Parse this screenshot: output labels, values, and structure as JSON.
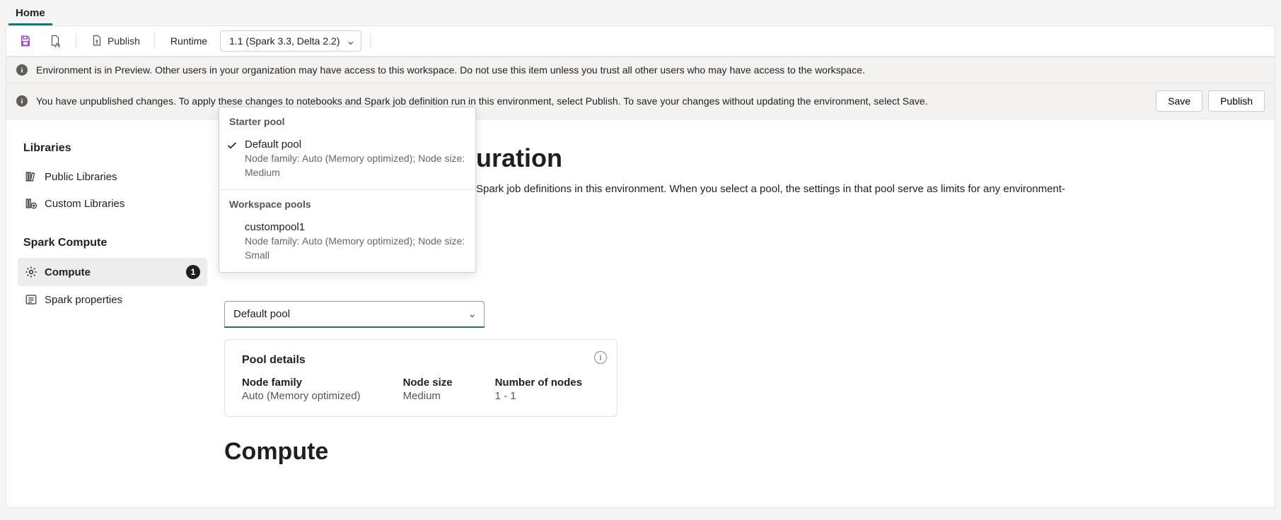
{
  "tab": {
    "home": "Home"
  },
  "toolbar": {
    "publish": "Publish",
    "runtime_label": "Runtime",
    "runtime_value": "1.1 (Spark 3.3, Delta 2.2)"
  },
  "banners": {
    "preview": "Environment is in Preview. Other users in your organization may have access to this workspace. Do not use this item unless you trust all other users who may have access to the workspace.",
    "unpublished": "You have unpublished changes. To apply these changes to notebooks and Spark job definition run in this environment, select Publish. To save your changes without updating the environment, select Save.",
    "save_btn": "Save",
    "publish_btn": "Publish"
  },
  "sidebar": {
    "libraries_head": "Libraries",
    "public": "Public Libraries",
    "custom": "Custom Libraries",
    "spark_head": "Spark Compute",
    "compute": "Compute",
    "compute_badge": "1",
    "spark_props": "Spark properties"
  },
  "content": {
    "title_fragment": "uration",
    "body_fragment": "Spark job definitions in this environment. When you select a pool, the settings in that pool serve as limits for any environment-"
  },
  "pool_field": {
    "value": "Default pool"
  },
  "pool_details": {
    "heading": "Pool details",
    "node_family_label": "Node family",
    "node_family_value": "Auto (Memory optimized)",
    "node_size_label": "Node size",
    "node_size_value": "Medium",
    "num_nodes_label": "Number of nodes",
    "num_nodes_value": "1 - 1"
  },
  "compute_heading": "Compute",
  "dropdown": {
    "sec1": "Starter pool",
    "item1_title": "Default pool",
    "item1_desc": "Node family: Auto (Memory optimized); Node size: Medium",
    "sec2": "Workspace pools",
    "item2_title": "custompool1",
    "item2_desc": "Node family: Auto (Memory optimized); Node size: Small"
  }
}
